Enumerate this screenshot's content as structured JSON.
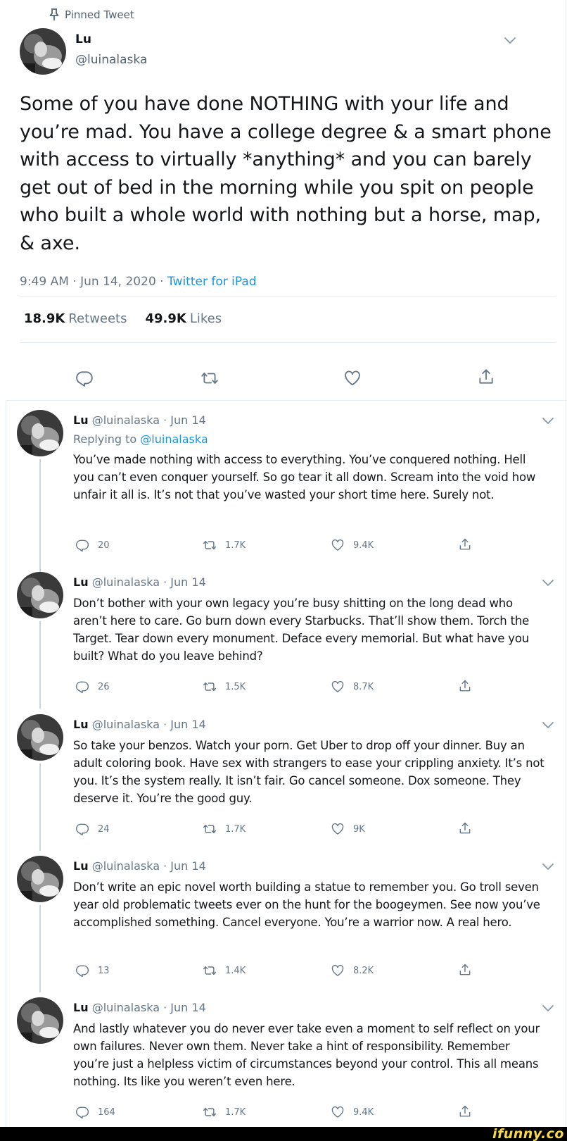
{
  "pinned_label": "Pinned Tweet",
  "main_tweet": {
    "name": "Lu",
    "handle": "@luinalaska",
    "text": "Some of you have done NOTHING with your life and you’re mad. You have a college degree & a smart phone with access to virtually *anything* and you can barely get out of bed in the morning while you spit on people who built a whole world with nothing but a horse, map, & axe.",
    "time": "9:49 AM · Jun 14, 2020 · ",
    "source": "Twitter for iPad",
    "retweets_count": "18.9K",
    "retweets_label": "Retweets",
    "likes_count": "49.9K",
    "likes_label": "Likes"
  },
  "replies": [
    {
      "name": "Lu",
      "handle_date": "@luinalaska · Jun 14",
      "replying_prefix": "Replying to ",
      "replying_to": "@luinalaska",
      "text": "You’ve made nothing with access to everything. You’ve conquered nothing. Hell you can’t even conquer yourself. So go tear it all down. Scream into the void how unfair it all is. It’s not that you’ve wasted your short time here. Surely not.",
      "replies": "20",
      "retweets": "1.7K",
      "likes": "9.4K"
    },
    {
      "name": "Lu",
      "handle_date": "@luinalaska · Jun 14",
      "text": "Don’t bother with your own legacy you’re busy shitting on the long dead who aren’t here to care. Go burn down every Starbucks. That’ll show them. Torch the Target. Tear down every monument. Deface every memorial. But what have you built? What do you leave behind?",
      "replies": "26",
      "retweets": "1.5K",
      "likes": "8.7K"
    },
    {
      "name": "Lu",
      "handle_date": "@luinalaska · Jun 14",
      "text": "So take your benzos. Watch your porn. Get Uber to drop off your dinner. Buy an adult coloring book. Have sex with strangers to ease your crippling anxiety. It’s not you. It’s the system really. It isn’t fair. Go cancel someone. Dox someone. They deserve it. You’re the good guy.",
      "replies": "24",
      "retweets": "1.7K",
      "likes": "9K"
    },
    {
      "name": "Lu",
      "handle_date": "@luinalaska · Jun 14",
      "text": "Don’t write an epic novel worth building a statue to remember you. Go troll seven year old problematic tweets ever on the hunt for the boogeymen. See now you’ve accomplished something. Cancel everyone. You’re a warrior now. A real hero.",
      "replies": "13",
      "retweets": "1.4K",
      "likes": "8.2K"
    },
    {
      "name": "Lu",
      "handle_date": "@luinalaska · Jun 14",
      "text": "And lastly whatever you do never ever take even a moment to self reflect on your own failures. Never own them. Never take a hint of responsibility. Remember you’re just a helpless victim of circumstances beyond your control. This all means nothing. Its like you weren’t even here.",
      "replies": "164",
      "retweets": "1.7K",
      "likes": "9.4K"
    }
  ],
  "watermark": "ifunny.co",
  "colors": {
    "link": "#1b95e0",
    "muted": "#657786",
    "text": "#14171a",
    "divider": "#e6ecf0"
  },
  "icons": [
    "pin-icon",
    "chevron-down-icon",
    "reply-icon",
    "retweet-icon",
    "like-icon",
    "share-icon"
  ]
}
